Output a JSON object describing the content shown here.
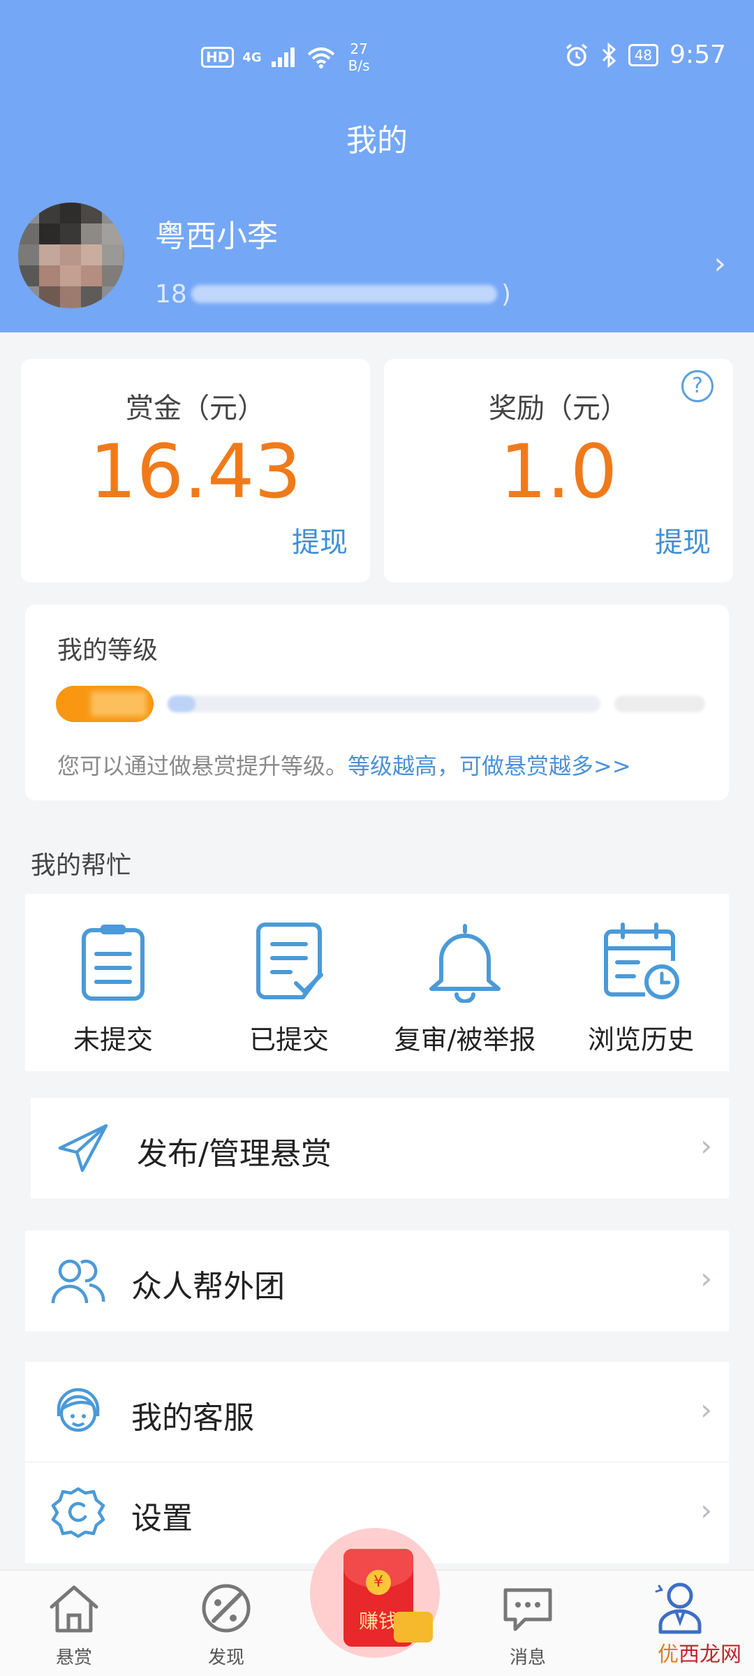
{
  "status_bar": {
    "hd_badge": "HD",
    "network": "4G",
    "speed_value": "27",
    "speed_unit": "B/s",
    "battery": "48",
    "time": "9:57"
  },
  "header": {
    "title": "我的",
    "username": "粤西小李",
    "phone_prefix": "18",
    "phone_suffix": ")"
  },
  "wallet": {
    "bounty_label": "赏金（元）",
    "bounty_value": "16.43",
    "bounty_action": "提现",
    "reward_label": "奖励（元）",
    "reward_value": "1.0",
    "reward_action": "提现",
    "help_glyph": "?"
  },
  "level": {
    "title": "我的等级",
    "tip_text": "您可以通过做悬赏提升等级。",
    "tip_link": "等级越高，可做悬赏越多>>"
  },
  "my_help": {
    "title": "我的帮忙",
    "items": [
      {
        "label": "未提交",
        "icon": "clipboard-icon"
      },
      {
        "label": "已提交",
        "icon": "document-check-icon"
      },
      {
        "label": "复审/被举报",
        "icon": "bell-icon"
      },
      {
        "label": "浏览历史",
        "icon": "calendar-clock-icon"
      }
    ]
  },
  "menu": [
    {
      "label": "发布/管理悬赏",
      "icon": "paper-plane-icon"
    },
    {
      "label": "众人帮外团",
      "icon": "users-icon"
    },
    {
      "label": "我的客服",
      "icon": "customer-service-icon"
    },
    {
      "label": "设置",
      "icon": "gear-icon"
    }
  ],
  "tabbar": {
    "items": [
      {
        "label": "悬赏",
        "icon": "home-icon"
      },
      {
        "label": "发现",
        "icon": "palette-icon"
      },
      {
        "label": "赚钱",
        "icon": "red-envelope-icon"
      },
      {
        "label": "消息",
        "icon": "chat-icon"
      },
      {
        "label": "",
        "icon": "profile-icon"
      }
    ],
    "earn_coin": "¥"
  },
  "watermark": {
    "pre": "优",
    "text": "西龙网"
  },
  "colors": {
    "header_bg": "#74a7f6",
    "accent_orange": "#f07a1a",
    "link_blue": "#3d8fd6",
    "icon_blue": "#4a9ad8",
    "background": "#f4f5f7"
  }
}
